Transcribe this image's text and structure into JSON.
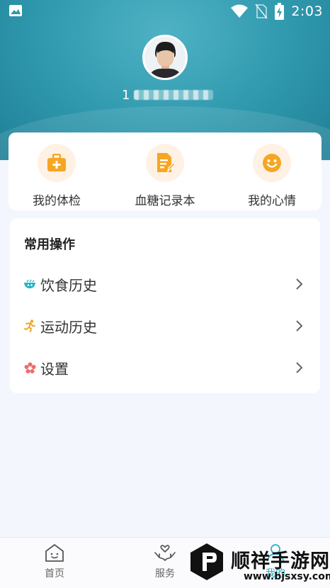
{
  "status_bar": {
    "time": "2:03",
    "icons": [
      "image-icon",
      "wifi-icon",
      "no-sim-icon",
      "battery-charging-icon"
    ]
  },
  "profile": {
    "user_id_visible": "1",
    "user_id_blurred": true
  },
  "quick_actions": [
    {
      "label": "我的体检",
      "icon": "medical-kit-icon"
    },
    {
      "label": "血糖记录本",
      "icon": "note-edit-icon"
    },
    {
      "label": "我的心情",
      "icon": "smile-icon"
    }
  ],
  "common_ops": {
    "title": "常用操作",
    "items": [
      {
        "label": "饮食历史",
        "icon": "bowl-icon"
      },
      {
        "label": "运动历史",
        "icon": "running-icon"
      },
      {
        "label": "设置",
        "icon": "flower-gear-icon"
      }
    ]
  },
  "bottom_nav": {
    "items": [
      {
        "label": "首页",
        "icon": "home-icon"
      },
      {
        "label": "服务",
        "icon": "care-hands-icon"
      },
      {
        "label": "我的",
        "icon": "user-icon"
      }
    ]
  },
  "watermark": {
    "title": "顺祥手游网",
    "url": "www.bjsxsy.com"
  },
  "colors": {
    "header": "#2f98ad",
    "accent_orange": "#f5a623",
    "icon_bg": "#fff1e4",
    "page_bg": "#f3f6fd"
  }
}
